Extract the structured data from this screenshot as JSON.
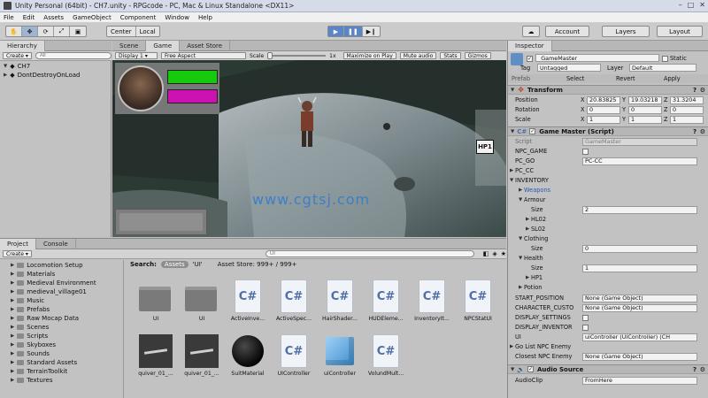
{
  "window": {
    "title": "Unity Personal (64bit) - CH7.unity - RPGcode - PC, Mac & Linux Standalone <DX11>"
  },
  "menu": [
    "File",
    "Edit",
    "Assets",
    "GameObject",
    "Component",
    "Window",
    "Help"
  ],
  "toolbar": {
    "center": "Center",
    "local": "Local",
    "account": "Account",
    "layers": "Layers",
    "layout": "Layout"
  },
  "hierarchy": {
    "tab": "Hierarchy",
    "create": "Create",
    "search_placeholder": "All",
    "items": [
      "CH7",
      "DontDestroyOnLoad"
    ]
  },
  "game_view": {
    "tabs": [
      "Scene",
      "Game",
      "Asset Store"
    ],
    "display": "Display 1",
    "aspect": "Free Aspect",
    "scale_label": "Scale",
    "scale_value": "1x",
    "buttons": [
      "Maximize on Play",
      "Mute audio",
      "Stats",
      "Gizmos"
    ],
    "hp_label": "HP1",
    "watermark": "www.cgtsj.com"
  },
  "inspector": {
    "tab": "Inspector",
    "object_name": "_GameMaster",
    "static_label": "Static",
    "tag_label": "Tag",
    "tag_value": "Untagged",
    "layer_label": "Layer",
    "layer_value": "Default",
    "prefab_label": "Prefab",
    "prefab_select": "Select",
    "prefab_revert": "Revert",
    "prefab_apply": "Apply",
    "transform": {
      "title": "Transform",
      "rows": [
        {
          "label": "Position",
          "x": "20.83825",
          "y": "19.03218",
          "z": "31.3204"
        },
        {
          "label": "Rotation",
          "x": "0",
          "y": "0",
          "z": "0"
        },
        {
          "label": "Scale",
          "x": "1",
          "y": "1",
          "z": "1"
        }
      ]
    },
    "script_component": {
      "title": "Game Master (Script)",
      "script_label": "Script",
      "script_value": "GameMaster",
      "npc_game": "NPC_GAME",
      "pc_go_label": "PC_GO",
      "pc_go_value": "PC-CC",
      "pc_cc": "PC_CC",
      "inventory": "INVENTORY",
      "weapons": "Weapons",
      "armour": "Armour",
      "armour_size_label": "Size",
      "armour_size": "2",
      "hl02": "HL02",
      "sl02": "SL02",
      "clothing": "Clothing",
      "clothing_size_label": "Size",
      "clothing_size": "0",
      "health": "Health",
      "health_size_label": "Size",
      "health_size": "1",
      "hp1": "HP1",
      "potion": "Potion",
      "start_position_label": "START_POSITION",
      "start_position_value": "None (Game Object)",
      "character_custom_label": "CHARACTER_CUSTO",
      "character_custom_value": "None (Game Object)",
      "display_settings": "DISPLAY_SETTINGS",
      "display_inventory": "DISPLAY_INVENTOR",
      "ui_label": "UI",
      "ui_value": "uiController (UIController) (CH",
      "go_list_npc": "Go List NPC Enemy",
      "closest_npc_label": "Closest NPC Enemy",
      "closest_npc_value": "None (Game Object)"
    },
    "audio_source": {
      "title": "Audio Source",
      "clip_label": "AudioClip",
      "clip_value": "FromHere"
    }
  },
  "project": {
    "tabs": [
      "Project",
      "Console"
    ],
    "create": "Create",
    "search_placeholder": "UI",
    "search_label": "Search:",
    "scope_assets": "Assets",
    "scope_ui": "'UI'",
    "asset_store": "Asset Store: 999+ / 999+",
    "folders": [
      "Locomotion Setup",
      "Materials",
      "Medieval Environment",
      "medieval_village01",
      "Music",
      "Prefabs",
      "Raw Mocap Data",
      "Scenes",
      "Scripts",
      "Skyboxes",
      "Sounds",
      "Standard Assets",
      "TerrainToolkit",
      "Textures"
    ],
    "assets_row1": [
      "UI",
      "UI",
      "ActiveInve...",
      "ActiveSpec...",
      "HairShader...",
      "HUDEleme...",
      "InventoryIt...",
      "NPCStatUI"
    ],
    "assets_row2": [
      "quiver_01_...",
      "quiver_01_...",
      "SuitMaterial",
      "UIController",
      "uiController",
      "VolundMult..."
    ]
  },
  "colors": {
    "health": "#15d30b",
    "mana": "#d511b8",
    "accent_play": "#5a86c8"
  }
}
